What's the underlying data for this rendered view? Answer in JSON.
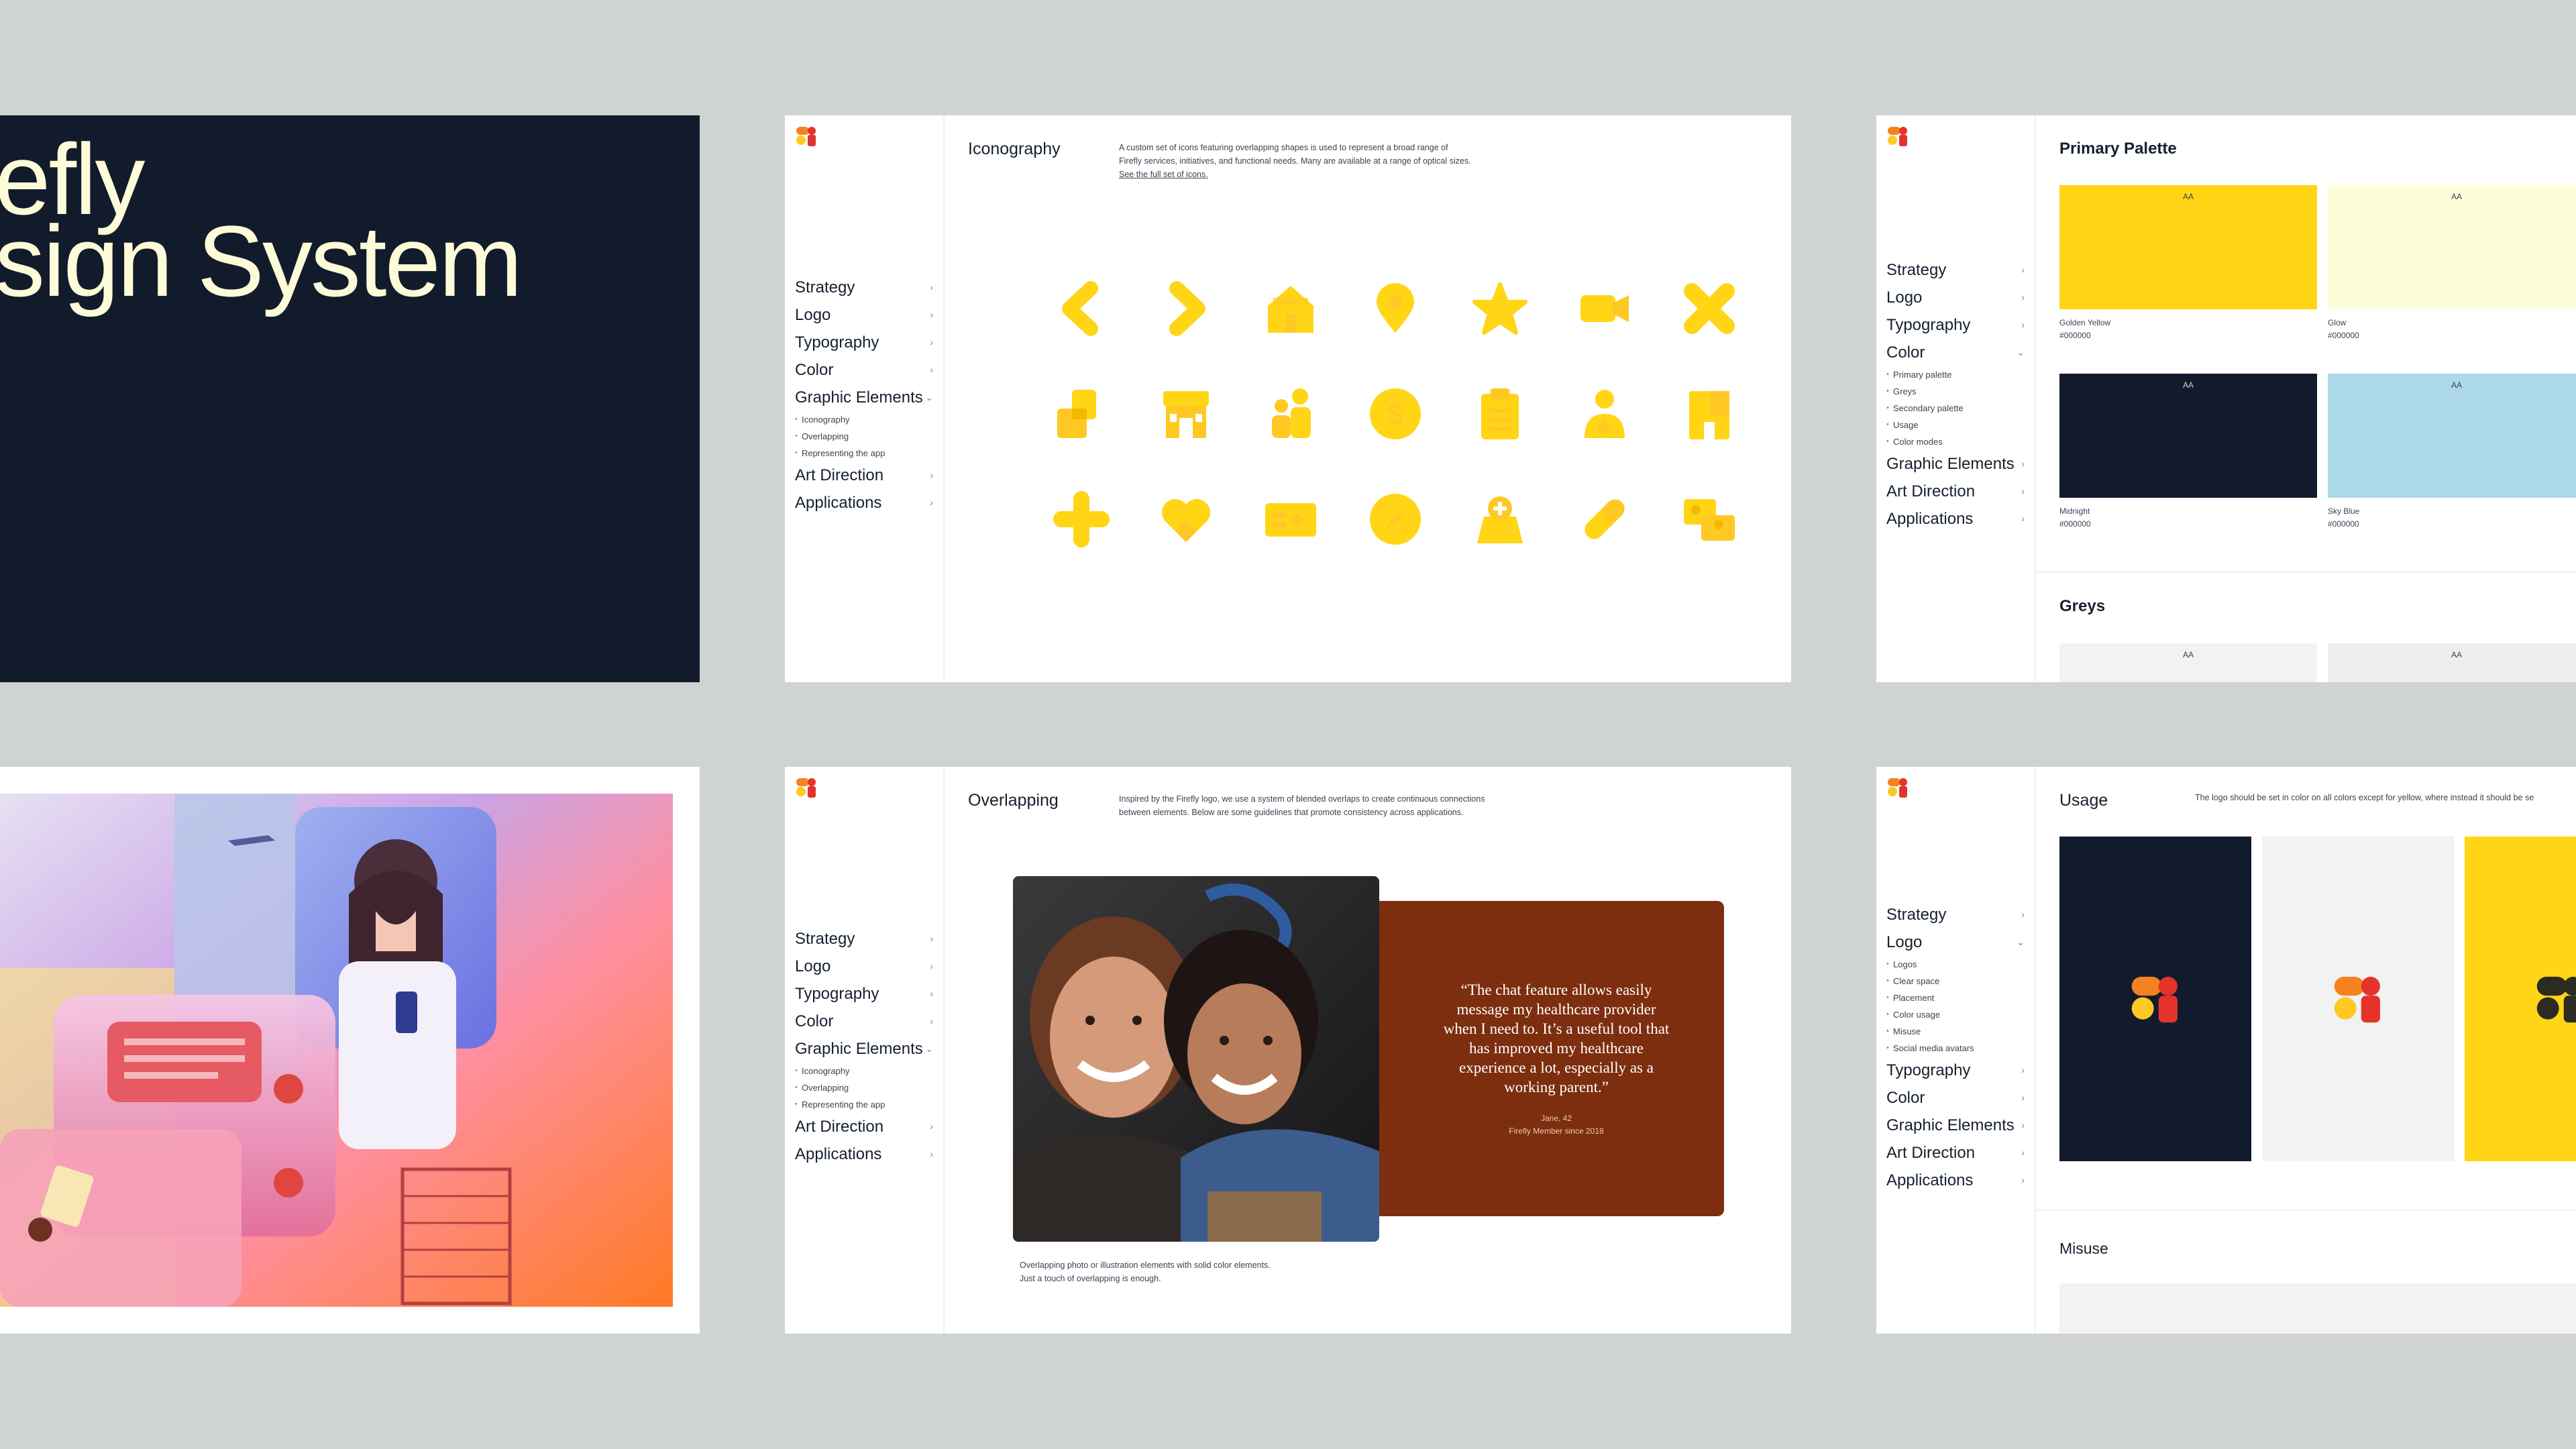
{
  "colors": {
    "background": "#cfd3d1",
    "midnight": "#121b2c",
    "golden_yellow": "#FFD516",
    "glow": "#FEFDD9",
    "sky_blue": "#ADD8E8",
    "grey": "#F2F2F2",
    "quote_brown": "#7C2E0F",
    "logo_red": "#E4332B",
    "logo_orange": "#F58220",
    "logo_yellow": "#FFC823"
  },
  "title_card": {
    "line1": "efly",
    "line2": "sign System"
  },
  "nav_graphic": {
    "items": [
      {
        "label": "Strategy",
        "chevron": "›"
      },
      {
        "label": "Logo",
        "chevron": "›"
      },
      {
        "label": "Typography",
        "chevron": "›"
      },
      {
        "label": "Color",
        "chevron": "›"
      },
      {
        "label": "Graphic Elements",
        "chevron": "⌄"
      },
      {
        "label": "Art Direction",
        "chevron": "›"
      },
      {
        "label": "Applications",
        "chevron": "›"
      }
    ],
    "subitems": [
      "Iconography",
      "Overlapping",
      "Representing the app"
    ]
  },
  "nav_color": {
    "items": [
      {
        "label": "Strategy",
        "chevron": "›"
      },
      {
        "label": "Logo",
        "chevron": "›"
      },
      {
        "label": "Typography",
        "chevron": "›"
      },
      {
        "label": "Color",
        "chevron": "⌄"
      },
      {
        "label": "Graphic Elements",
        "chevron": "›"
      },
      {
        "label": "Art Direction",
        "chevron": "›"
      },
      {
        "label": "Applications",
        "chevron": "›"
      }
    ],
    "subitems": [
      "Primary palette",
      "Greys",
      "Secondary palette",
      "Usage",
      "Color modes"
    ]
  },
  "nav_logo": {
    "items": [
      {
        "label": "Strategy",
        "chevron": "›"
      },
      {
        "label": "Logo",
        "chevron": "⌄"
      },
      {
        "label": "Typography",
        "chevron": "›"
      },
      {
        "label": "Color",
        "chevron": "›"
      },
      {
        "label": "Graphic Elements",
        "chevron": "›"
      },
      {
        "label": "Art Direction",
        "chevron": "›"
      },
      {
        "label": "Applications",
        "chevron": "›"
      }
    ],
    "subitems": [
      "Logos",
      "Clear space",
      "Placement",
      "Color usage",
      "Misuse",
      "Social media avatars"
    ]
  },
  "iconography": {
    "title": "Iconography",
    "desc_lines": [
      "A custom set of icons featuring overlapping shapes is used to represent a broad range of",
      "Firefly services, initiatives, and functional needs. Many are available at a range of optical sizes."
    ],
    "link": "See the full set of icons.",
    "icons": [
      "chevron-left-icon",
      "chevron-right-icon",
      "home-icon",
      "location-pin-icon",
      "star-icon",
      "video-camera-icon",
      "close-x-icon",
      "overlap-squares-icon",
      "storefront-icon",
      "family-icon",
      "dollar-coin-icon",
      "clipboard-icon",
      "person-plus-icon",
      "building-icon",
      "plus-icon",
      "heart-icon",
      "id-card-icon",
      "compass-icon",
      "hospital-bag-icon",
      "pill-capsule-icon",
      "id-overlap-icon"
    ]
  },
  "palette": {
    "title": "Primary Palette",
    "swatches": [
      {
        "aa": "AA",
        "name": "Golden Yellow",
        "hex": "#000000"
      },
      {
        "aa": "AA",
        "name": "Glow",
        "hex": "#000000"
      },
      {
        "aa": "AA",
        "name": "Midnight",
        "hex": "#000000"
      },
      {
        "aa": "AA",
        "name": "Sky Blue",
        "hex": "#000000"
      }
    ],
    "greys_title": "Greys",
    "grey_swatches": [
      "AA",
      "AA"
    ]
  },
  "overlapping": {
    "title": "Overlapping",
    "desc_lines": [
      "Inspired by the Firefly logo, we use a system of blended overlaps to create continuous connections",
      "between elements. Below are some guidelines that promote consistency across applications."
    ],
    "quote_lines": [
      "“The chat feature allows easily",
      "message my healthcare provider",
      "when I need to. It’s a useful tool that",
      "has improved my healthcare",
      "experience a lot, especially as a",
      "working parent.”"
    ],
    "attribution_name": "Jane, 42",
    "attribution_member": "Firefly Member since 2018",
    "caption_lines": [
      "Overlapping photo or illustration elements with solid color elements.",
      "Just a touch of overlapping is enough."
    ]
  },
  "usage": {
    "title": "Usage",
    "desc": "The logo should be set in color on all colors except for yellow, where instead it should be se",
    "misuse_title": "Misuse"
  }
}
